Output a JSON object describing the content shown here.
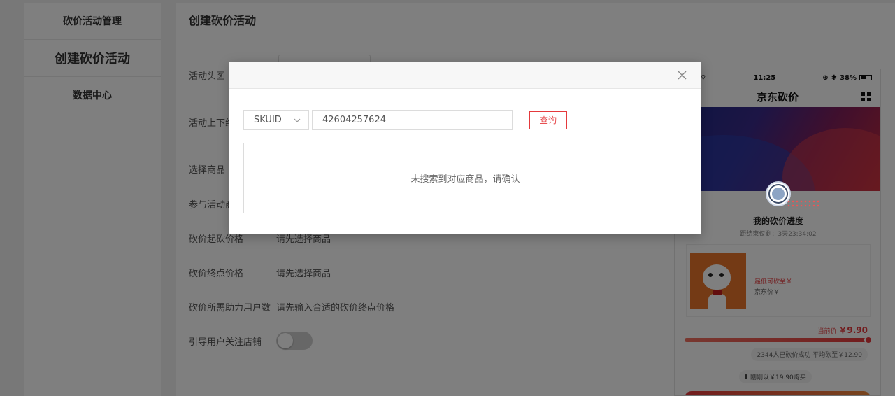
{
  "sidebar": {
    "items": [
      {
        "label": "砍价活动管理"
      },
      {
        "label": "创建砍价活动"
      },
      {
        "label": "数据中心"
      }
    ]
  },
  "main": {
    "title": "创建砍价活动",
    "form": {
      "banner_label": "活动头图",
      "online_label": "活动上下线",
      "select_goods_label": "选择商品",
      "join_goods_label": "参与活动商",
      "start_price_label": "砍价起砍价格",
      "start_price_value": "请先选择商品",
      "end_price_label": "砍价终点价格",
      "end_price_value": "请先选择商品",
      "helpers_label": "砍价所需助力用户数",
      "helpers_value": "请先输入合适的砍价终点价格",
      "follow_shop_label": "引导用户关注店铺",
      "follow_shop_enabled": false
    }
  },
  "phone": {
    "time": "11:25",
    "battery": "38%",
    "title": "京东砍价",
    "progress_title": "我的砍价进度",
    "countdown": "距结束仅剩：3天23:34:02",
    "lowest_price": "最低可砍至￥",
    "jd_price": "京东价￥",
    "current_price_label": "当前价",
    "current_price_value": "￥9.90",
    "progress": 1.0,
    "success_text": "2344人已砍价成功 平均砍至￥12.90",
    "buy_text": "刚刚以￥19.90购买"
  },
  "modal": {
    "select_value": "SKUID",
    "search_value": "42604257624",
    "query_label": "查询",
    "empty_text": "未搜索到对应商品，请确认"
  },
  "colors": {
    "accent": "#e4393c",
    "overlay": "rgba(0,0,0,0.5)"
  }
}
